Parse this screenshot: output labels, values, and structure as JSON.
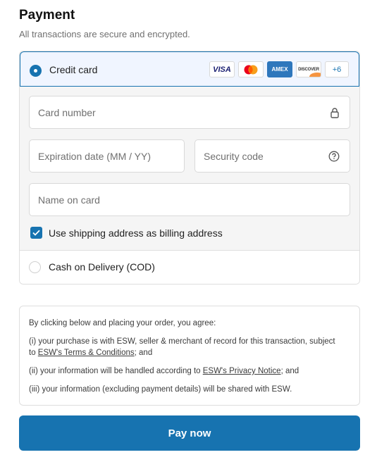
{
  "header": {
    "title": "Payment",
    "subtitle": "All transactions are secure and encrypted."
  },
  "methods": {
    "credit_card": {
      "label": "Credit card",
      "selected": true,
      "brands": [
        "VISA",
        "mastercard",
        "AMEX",
        "DISCOVER"
      ],
      "more_brands": "+6"
    },
    "cod": {
      "label": "Cash on Delivery (COD)",
      "selected": false
    }
  },
  "fields": {
    "card_number": "Card number",
    "expiration": "Expiration date (MM / YY)",
    "security_code": "Security code",
    "name_on_card": "Name on card"
  },
  "billing": {
    "checkbox_label": "Use shipping address as billing address",
    "checked": true
  },
  "terms": {
    "intro": "By clicking below and placing your order, you agree:",
    "item1_pre": "(i) your purchase is with ESW, seller & merchant of record for this transaction, subject to ",
    "item1_link": "ESW's Terms & Conditions",
    "item1_post": "; and",
    "item2_pre": "(ii) your information will be handled according to ",
    "item2_link": "ESW's Privacy Notice",
    "item2_post": "; and",
    "item3": "(iii) your information (excluding payment details) will be shared with ESW."
  },
  "actions": {
    "pay_now": "Pay now"
  },
  "colors": {
    "accent": "#1773b0",
    "selected_bg": "#f0f5ff"
  }
}
